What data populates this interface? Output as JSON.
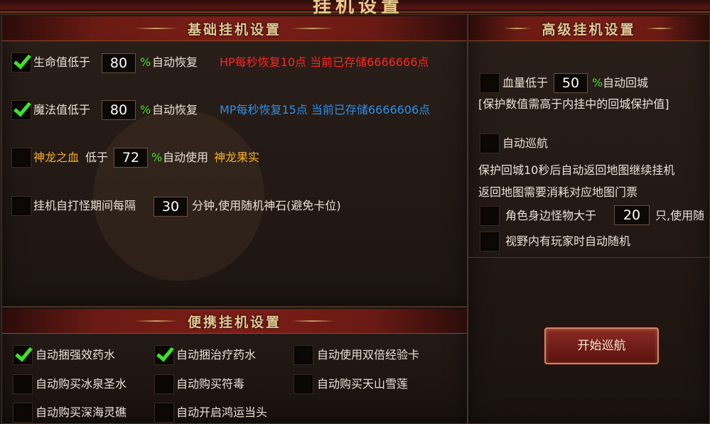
{
  "window": {
    "title": "挂机设置"
  },
  "basic": {
    "header": "基础挂机设置",
    "hp": {
      "label": "生命值低于",
      "value": "80",
      "pct": "%",
      "suffix": "自动恢复",
      "info": "HP每秒恢复10点 当前已存储6666666点",
      "checked": true
    },
    "mp": {
      "label": "魔法值低于",
      "value": "80",
      "pct": "%",
      "suffix": "自动恢复",
      "info": "MP每秒恢复15点 当前已存储6666606点",
      "checked": true
    },
    "blood": {
      "item": "神龙之血",
      "label": "低于",
      "value": "72",
      "pct": "%",
      "suffix": "自动使用",
      "fruit": "神龙果实",
      "checked": false
    },
    "stone": {
      "label": "挂机自打怪期间每隔",
      "value": "30",
      "suffix": "分钟,使用随机神石(避免卡位)",
      "checked": false
    }
  },
  "advanced": {
    "header": "高级挂机设置",
    "hp_city": {
      "label": "血量低于",
      "value": "50",
      "pct": "%",
      "suffix": "自动回城",
      "note": "[保护数值需高于内挂中的回城保护值]",
      "checked": false
    },
    "cruise": {
      "label": "自动巡航",
      "checked": false,
      "note1": "保护回城10秒后自动返回地图继续挂机",
      "note2": "返回地图需要消耗对应地图门票"
    },
    "monsters": {
      "label": "角色身边怪物大于",
      "value": "20",
      "suffix": "只,使用随",
      "checked": false
    },
    "players": {
      "label": "视野内有玩家时自动随机",
      "checked": false
    },
    "start_button": "开始巡航"
  },
  "portable": {
    "header": "便携挂机设置",
    "items": [
      {
        "label": "自动捆强效药水",
        "checked": true
      },
      {
        "label": "自动捆治疗药水",
        "checked": true
      },
      {
        "label": "自动使用双倍经验卡",
        "checked": false
      },
      {
        "label": "自动购买冰泉圣水",
        "checked": false
      },
      {
        "label": "自动购买符毒",
        "checked": false
      },
      {
        "label": "自动购买天山雪莲",
        "checked": false
      },
      {
        "label": "自动购买深海灵礁",
        "checked": false
      },
      {
        "label": "自动开启鸿运当头",
        "checked": false
      }
    ]
  },
  "colors": {
    "accent_green": "#3fe02a",
    "hp_red": "#ff2424",
    "mp_blue": "#2f8fe6",
    "gold": "#f3b021"
  }
}
